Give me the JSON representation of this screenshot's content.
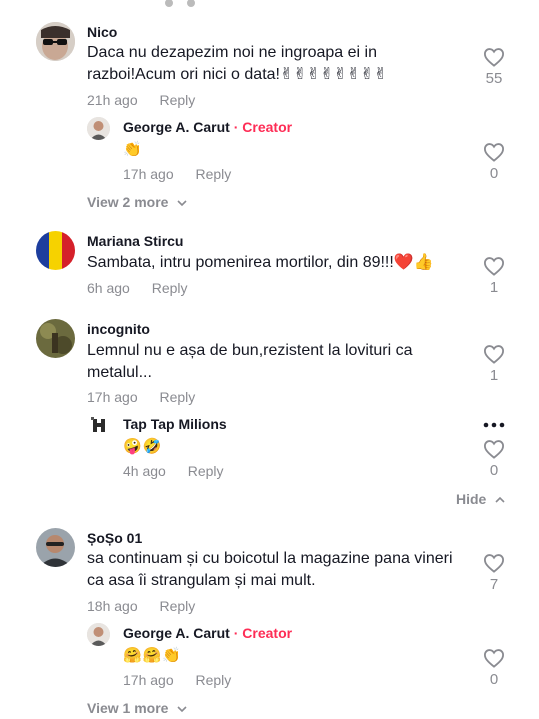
{
  "comments": [
    {
      "username": "Nico",
      "text": "Daca nu dezapezim noi ne ingroapa ei in razboi!Acum ori nici o data!✌✌✌✌✌✌✌✌",
      "time": "21h ago",
      "reply_label": "Reply",
      "likes": "55",
      "replies": [
        {
          "username": "George A. Carut",
          "badge": "· Creator",
          "text": "👏",
          "time": "17h ago",
          "reply_label": "Reply",
          "likes": "0"
        }
      ],
      "view_more": "View 2 more"
    },
    {
      "username": "Mariana Stircu",
      "text": "Sambata, intru pomenirea mortilor, din 89!!!❤️👍",
      "time": "6h ago",
      "reply_label": "Reply",
      "likes": "1"
    },
    {
      "username": "incognito",
      "text": "Lemnul nu e așa de bun,rezistent la lovituri ca metalul...",
      "time": "17h ago",
      "reply_label": "Reply",
      "likes": "1",
      "replies": [
        {
          "username": "Tap Tap Milions",
          "text": "🤪🤣",
          "time": "4h ago",
          "reply_label": "Reply",
          "likes": "0"
        }
      ],
      "hide_label": "Hide"
    },
    {
      "username": "ȘoȘo 01",
      "text": "sa continuam și cu boicotul la magazine pana vineri ca asa îi strangulam și mai mult.",
      "time": "18h ago",
      "reply_label": "Reply",
      "likes": "7",
      "replies": [
        {
          "username": "George A. Carut",
          "badge": "· Creator",
          "text": "🤗🤗👏",
          "time": "17h ago",
          "reply_label": "Reply",
          "likes": "0"
        }
      ],
      "view_more": "View 1 more"
    }
  ],
  "colors": {
    "creator": "#fe2c55",
    "meta": "#8a8b91",
    "text": "#161823"
  }
}
